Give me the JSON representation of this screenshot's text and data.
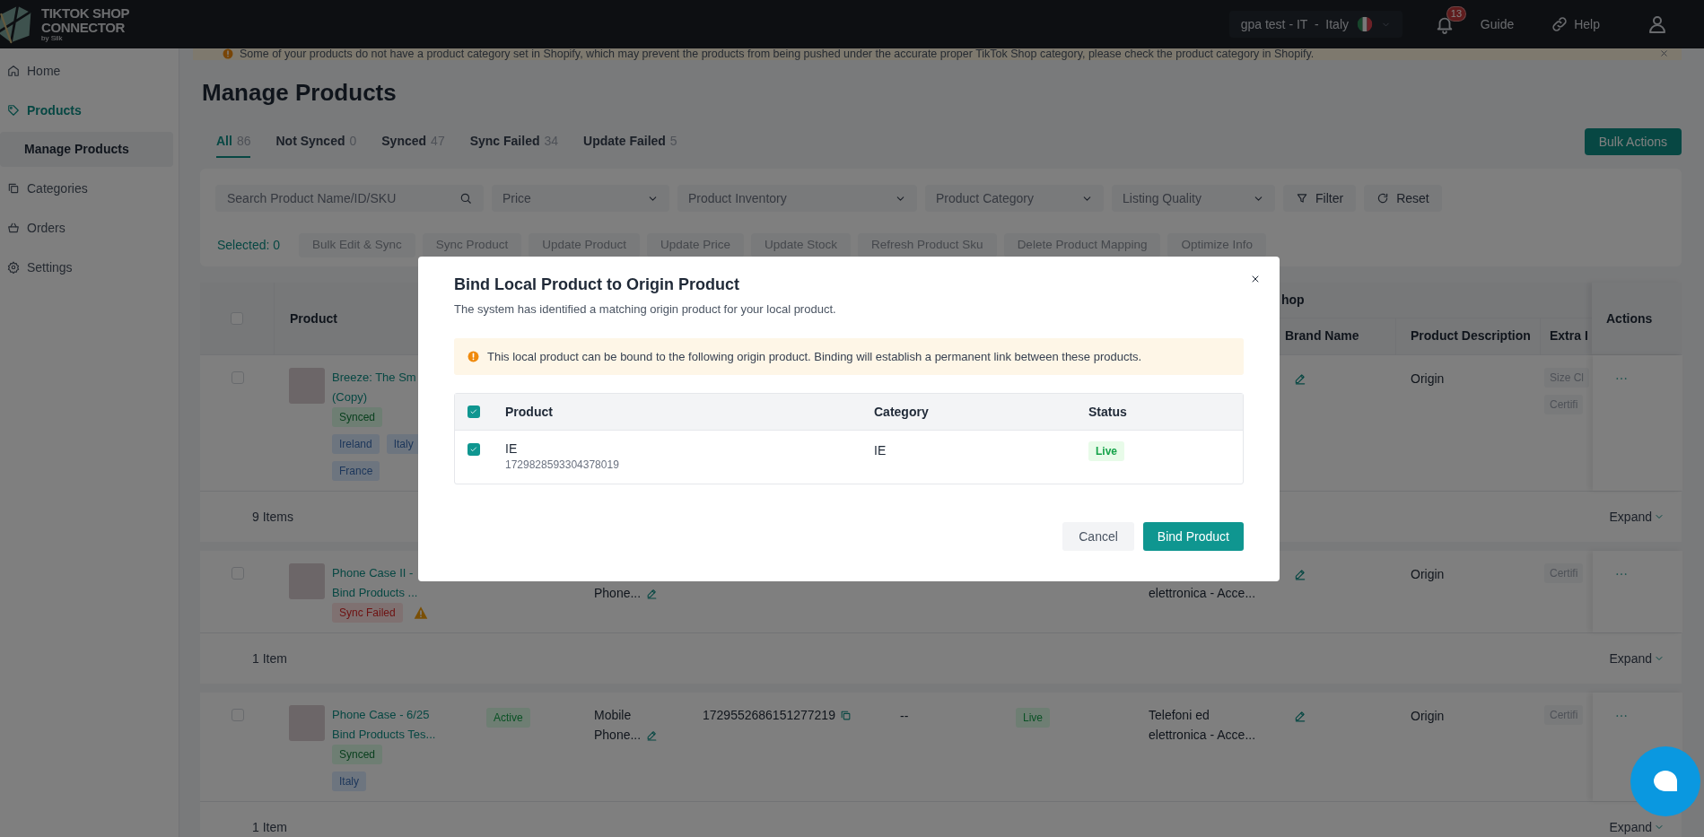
{
  "header": {
    "logo": {
      "line_1": "TIKTOK SHOP",
      "line_2": "CONNECTOR",
      "byline": "by Silk"
    },
    "store": "gpa test - IT  -  Italy",
    "notification_count": "13",
    "links": [
      {
        "label": "Guide",
        "kind": "plain"
      },
      {
        "label": "Help",
        "kind": "link"
      }
    ]
  },
  "sidebar": {
    "items": [
      {
        "label": "Home",
        "kind": "home",
        "selected": false
      },
      {
        "label": "Products",
        "kind": "tag",
        "selected": true,
        "children": [
          {
            "label": "Manage Products",
            "selected": true
          }
        ]
      },
      {
        "label": "Categories",
        "kind": "copy",
        "selected": false
      },
      {
        "label": "Orders",
        "kind": "basket",
        "selected": false
      },
      {
        "label": "Settings",
        "kind": "gear",
        "selected": false
      }
    ]
  },
  "banner": {
    "text": "Some of your products do not have a product category set in Shopify, which may prevent the products from being pushed under the accurate proper TikTok Shop category, please check the product category in Shopify."
  },
  "page_title": "Manage Products",
  "tabs": [
    {
      "label": "All",
      "count": "86",
      "selected": true
    },
    {
      "label": "Not Synced",
      "count": "0",
      "selected": false
    },
    {
      "label": "Synced",
      "count": "47",
      "selected": false
    },
    {
      "label": "Sync Failed",
      "count": "34",
      "selected": false
    },
    {
      "label": "Update Failed",
      "count": "5",
      "selected": false
    }
  ],
  "bulk_actions": "Bulk Actions",
  "filters": {
    "search": {
      "placeholder": "Search Product Name/ID/SKU"
    },
    "dropdowns": [
      {
        "placeholder": "Price"
      },
      {
        "placeholder": "Product Inventory"
      },
      {
        "placeholder": "Product Category"
      },
      {
        "placeholder": "Listing Quality"
      }
    ],
    "buttons": [
      {
        "label": "Filter",
        "kind": "filter"
      },
      {
        "label": "Reset",
        "kind": "reset"
      }
    ]
  },
  "selection": {
    "label": "Selected: 0",
    "actions": [
      {
        "label": "Bulk Edit & Sync",
        "disabled": true
      },
      {
        "label": "Sync Product",
        "disabled": true
      },
      {
        "label": "Update Product",
        "disabled": true
      },
      {
        "label": "Update Price",
        "disabled": true
      },
      {
        "label": "Update Stock",
        "disabled": true
      },
      {
        "label": "Refresh Product Sku",
        "disabled": true
      },
      {
        "label": "Delete Product Mapping",
        "disabled": true
      },
      {
        "label": "Optimize Info",
        "disabled": true
      }
    ]
  },
  "table": {
    "all_checked": false,
    "group_header": "hop",
    "columns": [
      "Product",
      "Brand Name",
      "Product Description",
      "Extra I",
      "Actions"
    ],
    "rows": [
      {
        "checked": false,
        "name_lines": [
          "Breeze: The Sm",
          "(Copy)"
        ],
        "sync": {
          "label": "Synced",
          "kind": "synced"
        },
        "warning": false,
        "regions": [
          "Ireland",
          "Italy",
          "France"
        ],
        "description": "Origin",
        "extra_tags": [
          "Size Cl",
          "Certifi"
        ],
        "item_count": "9 Items",
        "expand": "Expand"
      },
      {
        "checked": false,
        "name_lines": [
          "Phone Case II -",
          "Bind Products ..."
        ],
        "sync": {
          "label": "Sync Failed",
          "kind": "failed"
        },
        "warning": true,
        "category_lines": [
          "Phone..."
        ],
        "tiktok_category_lines": [
          "elettronica - Acce..."
        ],
        "description": "Origin",
        "extra_tags": [
          "Certifi"
        ],
        "item_count": "1 Item",
        "expand": "Expand"
      },
      {
        "checked": false,
        "name_lines": [
          "Phone Case - 6/25",
          "Bind Products Tes..."
        ],
        "sync": {
          "label": "Synced",
          "kind": "synced"
        },
        "warning": false,
        "regions": [
          "Italy"
        ],
        "status": "Active",
        "category_lines": [
          "Mobile",
          "Phone..."
        ],
        "product_id": "1729552686151277219",
        "column_6": "--",
        "listing_status": "Live",
        "tiktok_category_lines": [
          "Telefoni ed",
          "elettronica - Acce..."
        ],
        "description": "Origin",
        "extra_tags": [
          "Certifi"
        ],
        "item_count": "1 Item",
        "expand": "Expand"
      }
    ]
  },
  "modal": {
    "title": "Bind Local Product to Origin Product",
    "subtitle": "The system has identified a matching origin product for your local product.",
    "notice": "This local product can be bound to the following origin product. Binding will establish a permanent link between these products.",
    "all_checked": true,
    "columns": [
      "Product",
      "Category",
      "Status"
    ],
    "rows": [
      {
        "checked": true,
        "name": "IE",
        "id": "1729828593304378019",
        "category": "IE",
        "status": "Live"
      }
    ],
    "buttons": [
      {
        "label": "Cancel",
        "kind": "secondary"
      },
      {
        "label": "Bind Product",
        "kind": "primary"
      }
    ]
  }
}
